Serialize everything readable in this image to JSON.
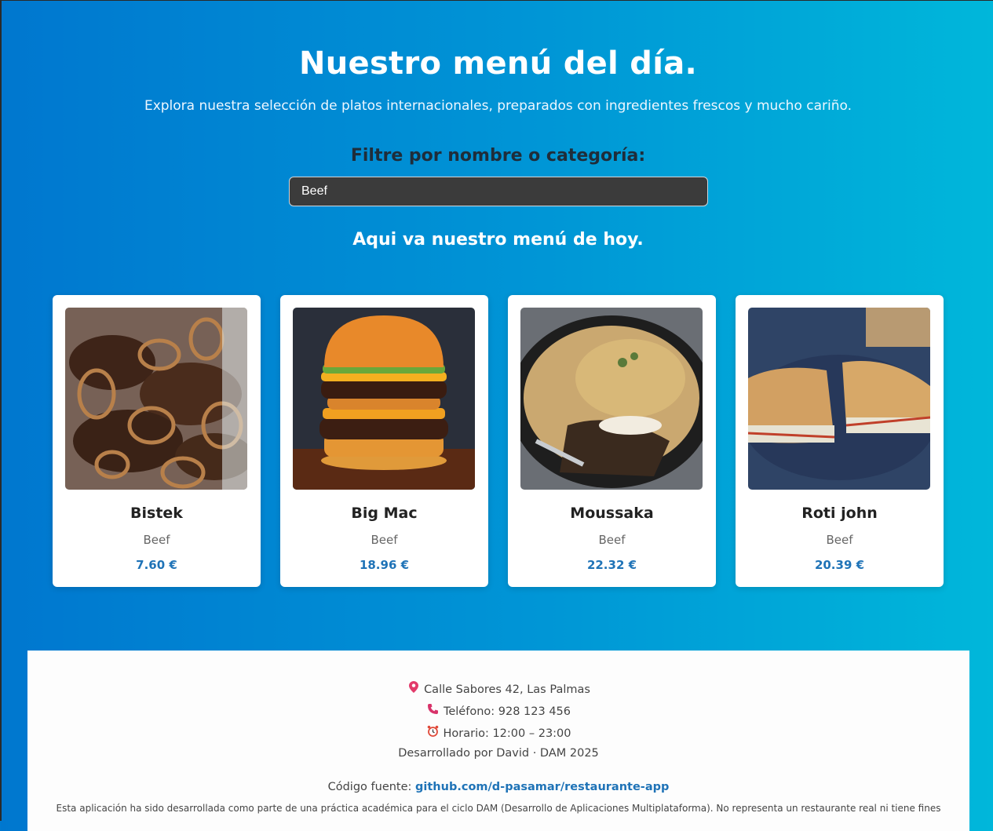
{
  "header": {
    "title": "Nuestro menú del día.",
    "subtitle": "Explora nuestra selección de platos internacionales, preparados con ingredientes frescos y mucho cariño."
  },
  "filter": {
    "label": "Filtre por nombre o categoría:",
    "value": "Beef"
  },
  "menu": {
    "title": "Aqui va nuestro menú de hoy.",
    "items": [
      {
        "name": "Bistek",
        "category": "Beef",
        "price": "7.60 €"
      },
      {
        "name": "Big Mac",
        "category": "Beef",
        "price": "18.96 €"
      },
      {
        "name": "Moussaka",
        "category": "Beef",
        "price": "22.32 €"
      },
      {
        "name": "Roti john",
        "category": "Beef",
        "price": "20.39 €"
      }
    ]
  },
  "footer": {
    "address": "Calle Sabores 42, Las Palmas",
    "phone": "Teléfono: 928 123 456",
    "hours": "Horario: 12:00 – 23:00",
    "credits": "Desarrollado por David · DAM 2025",
    "source_label": "Código fuente:",
    "source_link": "github.com/d-pasamar/restaurante-app",
    "disclaimer": "Esta aplicación ha sido desarrollada como parte de una práctica académica para el ciclo DAM (Desarrollo de Aplicaciones Multiplataforma). No representa un restaurante real ni tiene fines"
  },
  "icons": {
    "address": "map-pin-icon",
    "phone": "phone-icon",
    "hours": "alarm-clock-icon"
  },
  "colors": {
    "gradient_start": "#0077cf",
    "gradient_end": "#00b7da",
    "price": "#1f73b7",
    "search_bg": "#3b3b3b"
  }
}
